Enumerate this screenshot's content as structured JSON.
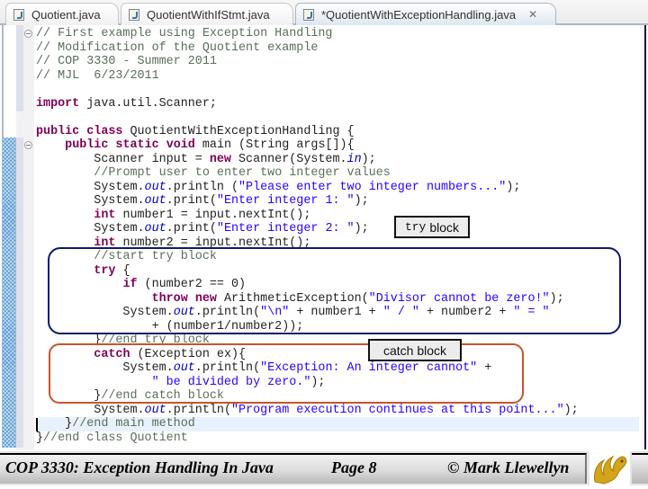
{
  "tabs": [
    {
      "label": "Quotient.java",
      "active": false,
      "dirty": false
    },
    {
      "label": "QuotientWithIfStmt.java",
      "active": false,
      "dirty": false
    },
    {
      "label": "*QuotientWithExceptionHandling.java",
      "active": true,
      "dirty": true,
      "close_icon": "close-icon"
    }
  ],
  "code_lines": [
    "// First example using Exception Handling",
    "// Modification of the Quotient example",
    "// COP 3330 - Summer 2011",
    "// MJL  6/23/2011",
    "",
    "import java.util.Scanner;",
    "",
    "public class QuotientWithExceptionHandling {",
    "    public static void main (String args[]){",
    "        Scanner input = new Scanner(System.in);",
    "        //Prompt user to enter two integer values",
    "        System.out.println (\"Please enter two integer numbers...\");",
    "        System.out.print(\"Enter integer 1: \");",
    "        int number1 = input.nextInt();",
    "        System.out.print(\"Enter integer 2: \");",
    "        int number2 = input.nextInt();",
    "        //start try block",
    "        try {",
    "            if (number2 == 0)",
    "                throw new ArithmeticException(\"Divisor cannot be zero!\");",
    "            System.out.println(\"\\n\" + number1 + \" / \" + number2 + \" = \"",
    "                + (number1/number2));",
    "        }//end try block",
    "        catch (Exception ex){",
    "            System.out.println(\"Exception: An integer cannot\" +",
    "                \" be divided by zero.\");",
    "        }//end catch block",
    "        System.out.println(\"Program execution continues at this point...\");",
    "    }//end main method",
    "}//end class Quotient"
  ],
  "callouts": {
    "try": {
      "code_word": "try",
      "text": "block",
      "color": "#0d1a6e"
    },
    "catch": {
      "text": "catch block",
      "color": "#c9542a"
    }
  },
  "footer": {
    "course_title": "COP 3330:  Exception Handling In Java",
    "page": "Page 8",
    "copyright": "© Mark Llewellyn",
    "logo_icon": "pegasus-logo-icon"
  },
  "colors": {
    "keyword": "#7f0055",
    "string": "#2a00ff",
    "comment": "#5a6e5a",
    "static_field": "#0000c0",
    "current_line": "#e8f2fe"
  }
}
